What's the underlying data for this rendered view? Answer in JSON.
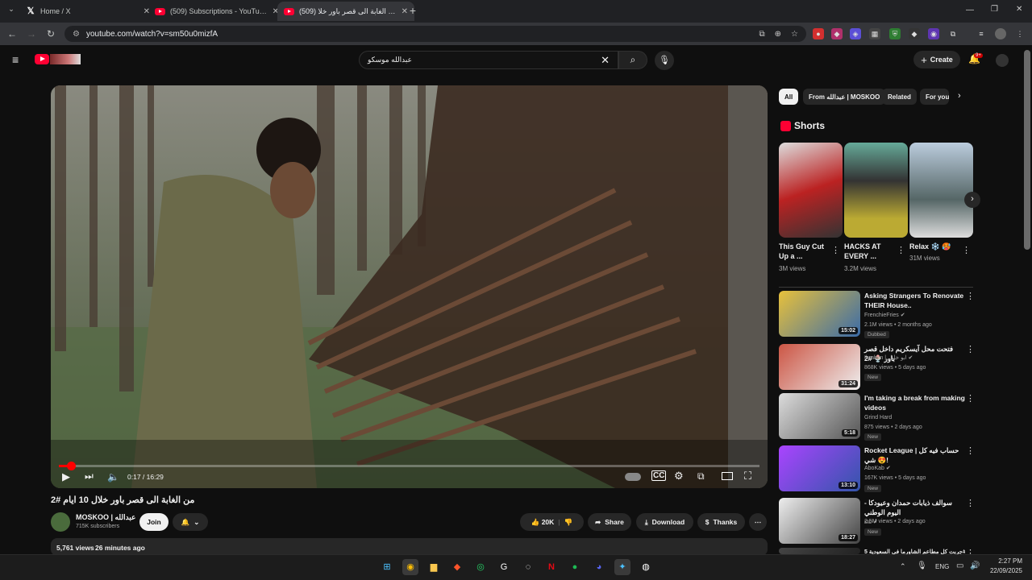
{
  "browser": {
    "tabs": [
      {
        "title": "Home / X",
        "active": false
      },
      {
        "title": "(509) Subscriptions - YouTube",
        "active": false
      },
      {
        "title": "(509) من الغابة الى قصر باور خلا",
        "active": true
      }
    ],
    "new_tab": "+",
    "url": "youtube.com/watch?v=sm50u0mizfA"
  },
  "youtube": {
    "search_value": "عبدالله موسكو",
    "create_label": "Create",
    "notif_count": "9+"
  },
  "player": {
    "time": "0:17 / 16:29",
    "progress": 0.017
  },
  "video": {
    "title": "من الغابة الى قصر باور خلال 10 ايام #2",
    "channel": "MOSKOO | عبدالله",
    "subscribers": "715K subscribers",
    "join": "Join",
    "likes": "20K",
    "share": "Share",
    "download": "Download",
    "thanks": "Thanks",
    "views": "5,761 views",
    "ago": "26 minutes ago"
  },
  "chips": [
    "All",
    "From عبدالله | MOSKOO",
    "Related",
    "For you"
  ],
  "shorts": {
    "heading": "Shorts",
    "items": [
      {
        "title": "This Guy Cut Up a ...",
        "views": "3M views"
      },
      {
        "title": "HACKS AT EVERY ...",
        "views": "3.2M views"
      },
      {
        "title": "Relax ❄️ 🥵",
        "views": "31M views"
      }
    ]
  },
  "recommended": [
    {
      "title": "Asking Strangers To Renovate THEIR House..",
      "channel": "FrenchieFries ✔",
      "meta": "2.1M views • 2 months ago",
      "badge": "Dubbed",
      "duration": "15:02"
    },
    {
      "title": "فتحت محل آيسكريم داخل قصر باور 🍨 #2",
      "channel": "Ibrahim | ابو خليل ✔",
      "meta": "868K views • 5 days ago",
      "badge": "New",
      "duration": "31:24"
    },
    {
      "title": "I'm taking a break from making videos",
      "channel": "Grind Hard",
      "meta": "875 views • 2 days ago",
      "badge": "New",
      "duration": "5:18"
    },
    {
      "title": "Rocket League | حساب فيه كل شي 😍!",
      "channel": "AboKab ✔",
      "meta": "167K views • 5 days ago",
      "badge": "New",
      "duration": "13:10"
    },
    {
      "title": "سوالف ذيابات حمدان وعيودكا - اليوم الوطني",
      "channel": "stc ✔",
      "meta": "2.5M views • 2 days ago",
      "badge": "New",
      "duration": "18:27"
    },
    {
      "title": "جربت كل مطاعم الشاورما في السعودية 5#",
      "channel": "",
      "meta": "",
      "badge": "",
      "duration": ""
    }
  ],
  "taskbar": {
    "lang": "ENG",
    "time": "2:27 PM",
    "date": "22/09/2025"
  }
}
